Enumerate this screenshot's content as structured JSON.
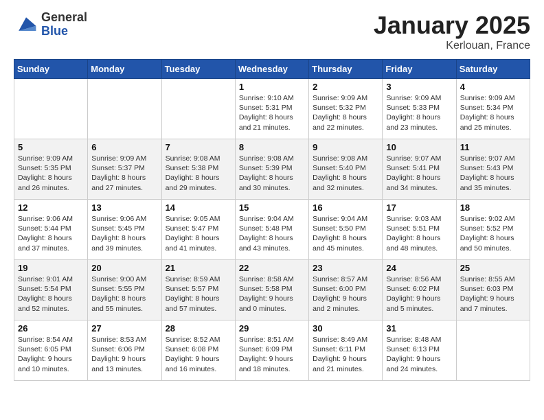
{
  "header": {
    "logo_general": "General",
    "logo_blue": "Blue",
    "month": "January 2025",
    "location": "Kerlouan, France"
  },
  "weekdays": [
    "Sunday",
    "Monday",
    "Tuesday",
    "Wednesday",
    "Thursday",
    "Friday",
    "Saturday"
  ],
  "weeks": [
    [
      {
        "day": "",
        "info": ""
      },
      {
        "day": "",
        "info": ""
      },
      {
        "day": "",
        "info": ""
      },
      {
        "day": "1",
        "info": "Sunrise: 9:10 AM\nSunset: 5:31 PM\nDaylight: 8 hours\nand 21 minutes."
      },
      {
        "day": "2",
        "info": "Sunrise: 9:09 AM\nSunset: 5:32 PM\nDaylight: 8 hours\nand 22 minutes."
      },
      {
        "day": "3",
        "info": "Sunrise: 9:09 AM\nSunset: 5:33 PM\nDaylight: 8 hours\nand 23 minutes."
      },
      {
        "day": "4",
        "info": "Sunrise: 9:09 AM\nSunset: 5:34 PM\nDaylight: 8 hours\nand 25 minutes."
      }
    ],
    [
      {
        "day": "5",
        "info": "Sunrise: 9:09 AM\nSunset: 5:35 PM\nDaylight: 8 hours\nand 26 minutes."
      },
      {
        "day": "6",
        "info": "Sunrise: 9:09 AM\nSunset: 5:37 PM\nDaylight: 8 hours\nand 27 minutes."
      },
      {
        "day": "7",
        "info": "Sunrise: 9:08 AM\nSunset: 5:38 PM\nDaylight: 8 hours\nand 29 minutes."
      },
      {
        "day": "8",
        "info": "Sunrise: 9:08 AM\nSunset: 5:39 PM\nDaylight: 8 hours\nand 30 minutes."
      },
      {
        "day": "9",
        "info": "Sunrise: 9:08 AM\nSunset: 5:40 PM\nDaylight: 8 hours\nand 32 minutes."
      },
      {
        "day": "10",
        "info": "Sunrise: 9:07 AM\nSunset: 5:41 PM\nDaylight: 8 hours\nand 34 minutes."
      },
      {
        "day": "11",
        "info": "Sunrise: 9:07 AM\nSunset: 5:43 PM\nDaylight: 8 hours\nand 35 minutes."
      }
    ],
    [
      {
        "day": "12",
        "info": "Sunrise: 9:06 AM\nSunset: 5:44 PM\nDaylight: 8 hours\nand 37 minutes."
      },
      {
        "day": "13",
        "info": "Sunrise: 9:06 AM\nSunset: 5:45 PM\nDaylight: 8 hours\nand 39 minutes."
      },
      {
        "day": "14",
        "info": "Sunrise: 9:05 AM\nSunset: 5:47 PM\nDaylight: 8 hours\nand 41 minutes."
      },
      {
        "day": "15",
        "info": "Sunrise: 9:04 AM\nSunset: 5:48 PM\nDaylight: 8 hours\nand 43 minutes."
      },
      {
        "day": "16",
        "info": "Sunrise: 9:04 AM\nSunset: 5:50 PM\nDaylight: 8 hours\nand 45 minutes."
      },
      {
        "day": "17",
        "info": "Sunrise: 9:03 AM\nSunset: 5:51 PM\nDaylight: 8 hours\nand 48 minutes."
      },
      {
        "day": "18",
        "info": "Sunrise: 9:02 AM\nSunset: 5:52 PM\nDaylight: 8 hours\nand 50 minutes."
      }
    ],
    [
      {
        "day": "19",
        "info": "Sunrise: 9:01 AM\nSunset: 5:54 PM\nDaylight: 8 hours\nand 52 minutes."
      },
      {
        "day": "20",
        "info": "Sunrise: 9:00 AM\nSunset: 5:55 PM\nDaylight: 8 hours\nand 55 minutes."
      },
      {
        "day": "21",
        "info": "Sunrise: 8:59 AM\nSunset: 5:57 PM\nDaylight: 8 hours\nand 57 minutes."
      },
      {
        "day": "22",
        "info": "Sunrise: 8:58 AM\nSunset: 5:58 PM\nDaylight: 9 hours\nand 0 minutes."
      },
      {
        "day": "23",
        "info": "Sunrise: 8:57 AM\nSunset: 6:00 PM\nDaylight: 9 hours\nand 2 minutes."
      },
      {
        "day": "24",
        "info": "Sunrise: 8:56 AM\nSunset: 6:02 PM\nDaylight: 9 hours\nand 5 minutes."
      },
      {
        "day": "25",
        "info": "Sunrise: 8:55 AM\nSunset: 6:03 PM\nDaylight: 9 hours\nand 7 minutes."
      }
    ],
    [
      {
        "day": "26",
        "info": "Sunrise: 8:54 AM\nSunset: 6:05 PM\nDaylight: 9 hours\nand 10 minutes."
      },
      {
        "day": "27",
        "info": "Sunrise: 8:53 AM\nSunset: 6:06 PM\nDaylight: 9 hours\nand 13 minutes."
      },
      {
        "day": "28",
        "info": "Sunrise: 8:52 AM\nSunset: 6:08 PM\nDaylight: 9 hours\nand 16 minutes."
      },
      {
        "day": "29",
        "info": "Sunrise: 8:51 AM\nSunset: 6:09 PM\nDaylight: 9 hours\nand 18 minutes."
      },
      {
        "day": "30",
        "info": "Sunrise: 8:49 AM\nSunset: 6:11 PM\nDaylight: 9 hours\nand 21 minutes."
      },
      {
        "day": "31",
        "info": "Sunrise: 8:48 AM\nSunset: 6:13 PM\nDaylight: 9 hours\nand 24 minutes."
      },
      {
        "day": "",
        "info": ""
      }
    ]
  ]
}
